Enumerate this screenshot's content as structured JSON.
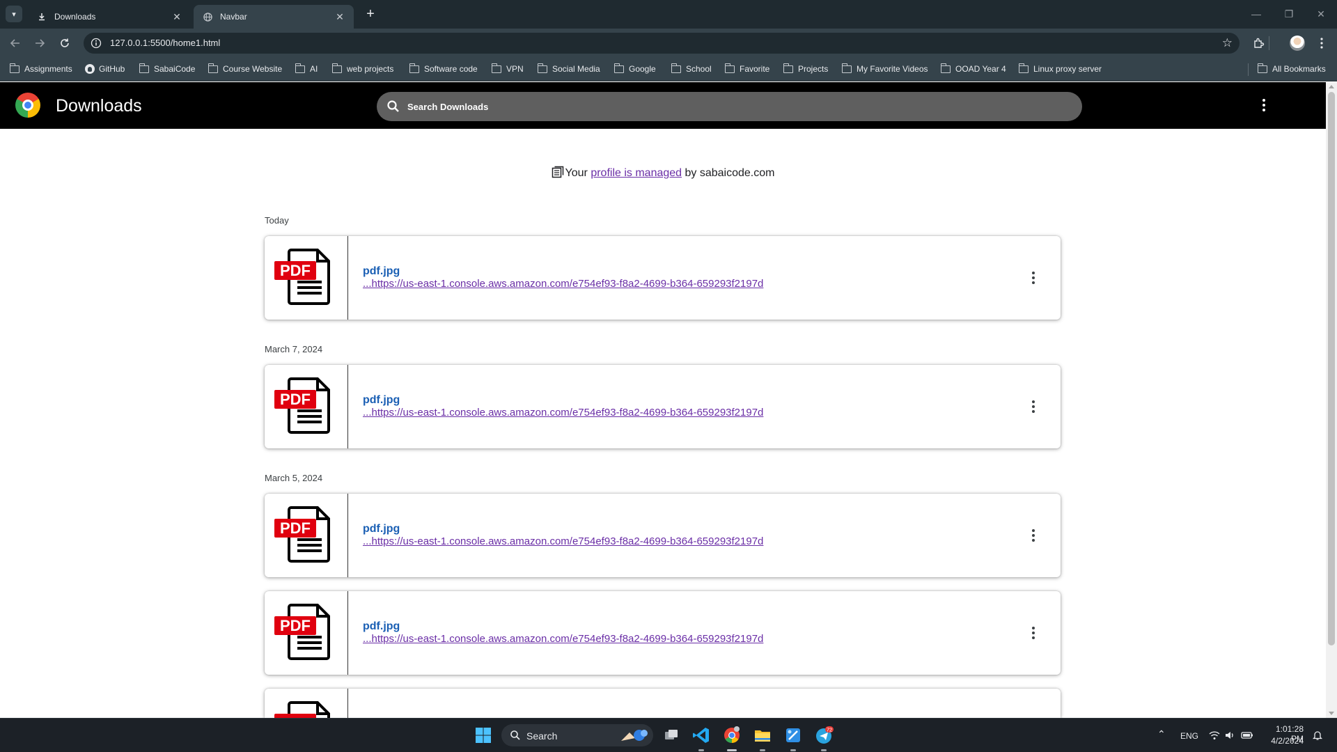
{
  "browser": {
    "tabs": [
      {
        "title": "Downloads",
        "icon": "download-icon",
        "active": false
      },
      {
        "title": "Navbar",
        "icon": "globe-icon",
        "active": true
      }
    ],
    "url": "127.0.0.1:5500/home1.html",
    "bookmarks": [
      {
        "label": "Assignments",
        "icon": "folder-icon"
      },
      {
        "label": "GitHub",
        "icon": "github-icon"
      },
      {
        "label": "SabaiCode",
        "icon": "folder-icon"
      },
      {
        "label": "Course Website",
        "icon": "folder-icon"
      },
      {
        "label": "AI",
        "icon": "folder-icon"
      },
      {
        "label": "web projects",
        "icon": "folder-icon"
      },
      {
        "label": "Software code",
        "icon": "folder-icon"
      },
      {
        "label": "VPN",
        "icon": "folder-icon"
      },
      {
        "label": "Social Media",
        "icon": "folder-icon"
      },
      {
        "label": "Google",
        "icon": "folder-icon"
      },
      {
        "label": "School",
        "icon": "folder-icon"
      },
      {
        "label": "Favorite",
        "icon": "folder-icon"
      },
      {
        "label": "Projects",
        "icon": "folder-icon"
      },
      {
        "label": "My Favorite Videos",
        "icon": "folder-icon"
      },
      {
        "label": "OOAD Year 4",
        "icon": "folder-icon"
      },
      {
        "label": "Linux proxy server",
        "icon": "folder-icon"
      }
    ],
    "all_bookmarks": "All Bookmarks"
  },
  "page": {
    "title": "Downloads",
    "search_placeholder": "Search Downloads",
    "managed": {
      "prefix": "Your ",
      "link": "profile is managed",
      "suffix": " by sabaicode.com"
    },
    "groups": [
      {
        "date": "Today",
        "items": [
          {
            "name": "pdf.jpg",
            "url": "...https://us-east-1.console.aws.amazon.com/e754ef93-f8a2-4699-b364-659293f2197d",
            "thumb_text": "PDF"
          }
        ]
      },
      {
        "date": "March 7, 2024",
        "items": [
          {
            "name": "pdf.jpg",
            "url": "...https://us-east-1.console.aws.amazon.com/e754ef93-f8a2-4699-b364-659293f2197d",
            "thumb_text": "PDF"
          }
        ]
      },
      {
        "date": "March 5, 2024",
        "items": [
          {
            "name": "pdf.jpg",
            "url": "...https://us-east-1.console.aws.amazon.com/e754ef93-f8a2-4699-b364-659293f2197d",
            "thumb_text": "PDF"
          },
          {
            "name": "pdf.jpg",
            "url": "...https://us-east-1.console.aws.amazon.com/e754ef93-f8a2-4699-b364-659293f2197d",
            "thumb_text": "PDF"
          },
          {
            "name": "",
            "url": "",
            "thumb_text": "PDF"
          }
        ]
      }
    ]
  },
  "taskbar": {
    "search_label": "Search",
    "telegram_badge": "72",
    "language": "ENG",
    "time": "1:01:28 PM",
    "date": "4/2/2024"
  },
  "colors": {
    "header_bg": "#000000",
    "search_bg": "#5f5f5f",
    "link_blue": "#1a5fb4",
    "link_purple": "#6a2ea6",
    "pdf_red": "#e0000f"
  }
}
